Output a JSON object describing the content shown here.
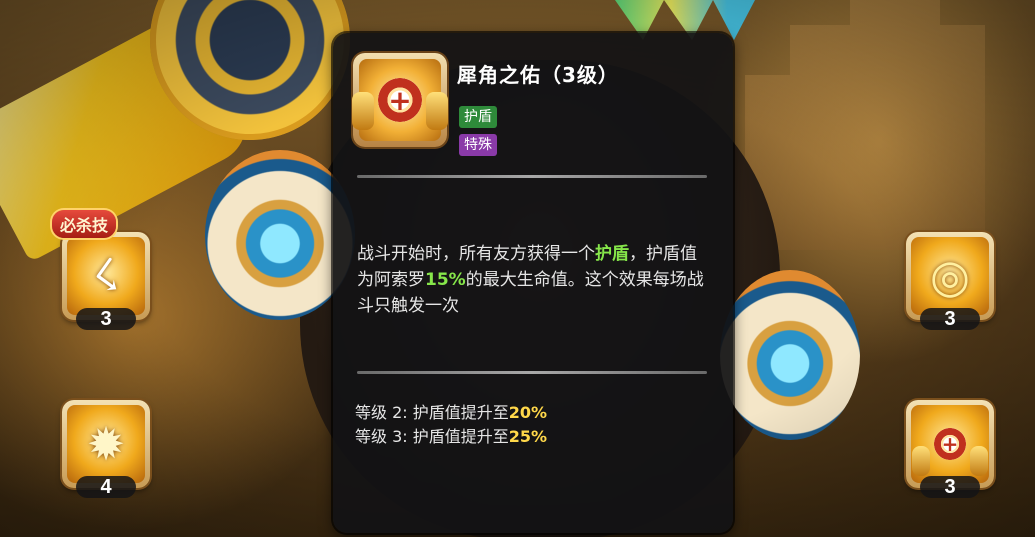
{
  "skill_tooltip": {
    "title": "犀角之佑（3级）",
    "icon": "rhino-shield-icon",
    "tags": [
      {
        "label": "护盾",
        "color": "#2e8a3a"
      },
      {
        "label": "特殊",
        "color": "#8a3aa8"
      }
    ],
    "description": {
      "part1": "战斗开始时，所有友方获得一个",
      "highlight_shield": "护盾",
      "part2": "，护盾值为阿索罗",
      "highlight_percent": "15%",
      "part3": "的最大生命值。这个效果每场战斗只触发一次"
    },
    "level_upgrades": [
      {
        "prefix": "等级 2: 护盾值提升至",
        "value": "20%"
      },
      {
        "prefix": "等级 3: 护盾值提升至",
        "value": "25%"
      }
    ],
    "highlight_colors": {
      "green": "#86e64a",
      "yellow": "#ffd84a"
    }
  },
  "skills": {
    "ultimate_badge": "必杀技",
    "left_top": {
      "icon": "slash-icon",
      "count": "3"
    },
    "left_bottom": {
      "icon": "spark-fist-icon",
      "count": "4"
    },
    "right_top": {
      "icon": "swirl-icon",
      "count": "3"
    },
    "right_bottom": {
      "icon": "rhino-shield-icon",
      "count": "3"
    }
  }
}
